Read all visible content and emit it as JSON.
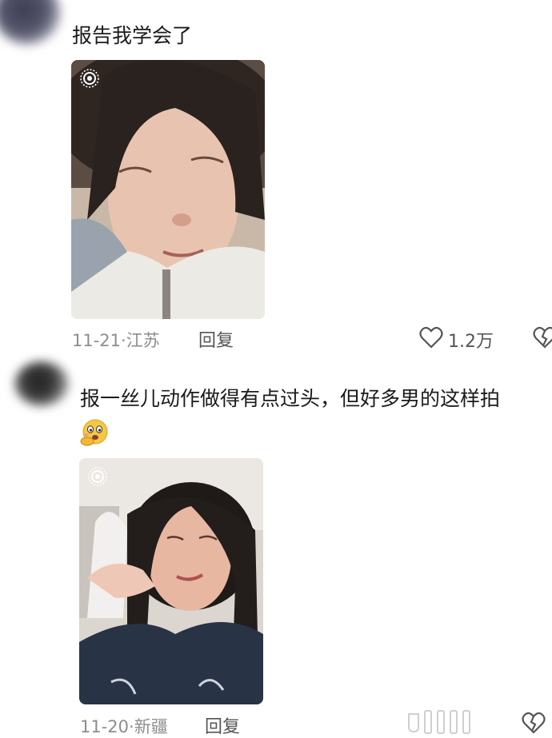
{
  "comments": [
    {
      "text": "报告我学会了",
      "date": "11-21",
      "location": "江苏",
      "reply_label": "回复",
      "like_count": "1.2万",
      "photo_icon": "live-photo-icon"
    },
    {
      "text": "报一丝儿动作做得有点过头，但好多男的这样拍",
      "emoji": "thinking-face-emoji",
      "date": "11-20",
      "location": "新疆",
      "reply_label": "回复",
      "photo_icon": "live-photo-icon"
    }
  ],
  "separator": "·",
  "icons": {
    "like": "heart-outline-icon",
    "dislike": "broken-heart-icon"
  },
  "colors": {
    "meta": "#8d8d8d",
    "text": "#1b1b1b",
    "background": "#ffffff"
  }
}
